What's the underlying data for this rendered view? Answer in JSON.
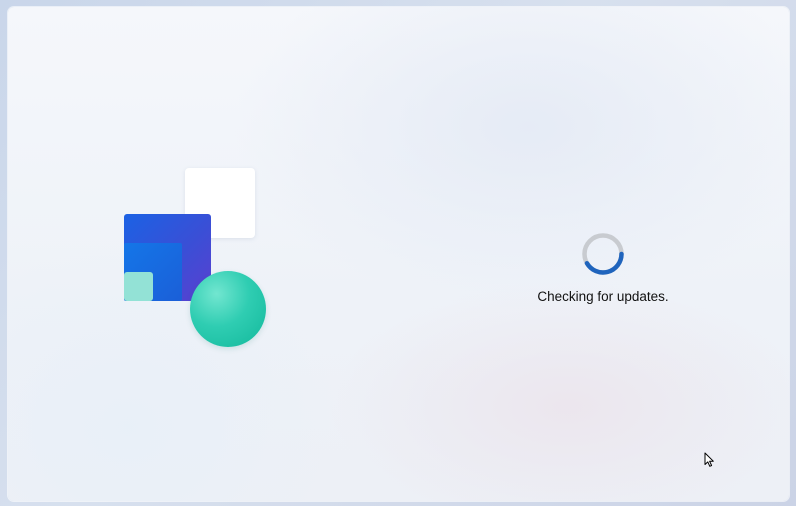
{
  "setup": {
    "status_text": "Checking for updates."
  },
  "colors": {
    "accent": "#1f64bd",
    "track": "#c8cbd0",
    "illustration_blue": "#1b62e4",
    "illustration_teal": "#2fcdb2",
    "illustration_mint": "#93e2d6"
  },
  "icons": {
    "spinner": "progress-ring-icon",
    "pointer": "mouse-cursor-icon"
  }
}
